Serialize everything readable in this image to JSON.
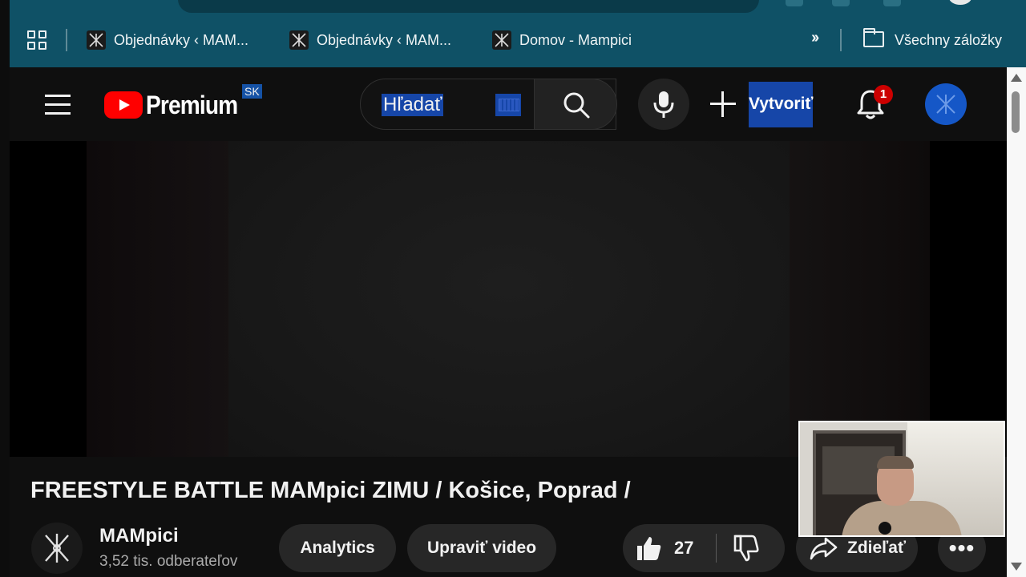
{
  "bookmarks": {
    "items": [
      {
        "label": "Objednávky ‹ MAM..."
      },
      {
        "label": "Objednávky ‹ MAM..."
      },
      {
        "label": "Domov - Mampici"
      }
    ],
    "all_label": "Všechny záložky",
    "more_icon": "chevron-double-right-icon"
  },
  "header": {
    "logo_text": "Premium",
    "region": "SK",
    "search_placeholder": "Hľadať",
    "create_label": "Vytvoriť",
    "notification_count": "1"
  },
  "video": {
    "title": "FREESTYLE BATTLE MAMpici ZIMU / Košice, Poprad /",
    "channel_name": "MAMpici",
    "subscribers": "3,52 tis. odberateľov",
    "analytics_label": "Analytics",
    "edit_label": "Upraviť video",
    "like_count": "27",
    "share_label": "Zdieľať",
    "more_label": "•••"
  },
  "colors": {
    "browser_chrome": "#0f5166",
    "yt_background": "#0f0f0f",
    "brand_red": "#ff0000",
    "selection_blue": "#1646a8",
    "pill_bg": "#272727"
  }
}
